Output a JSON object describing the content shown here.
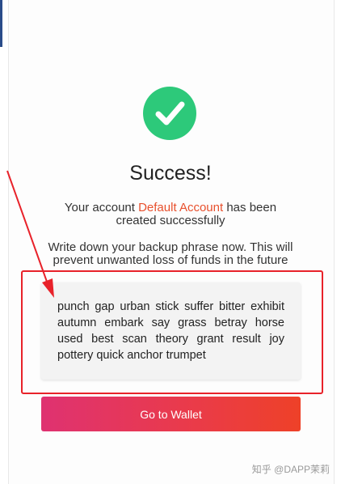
{
  "success": {
    "title": "Success!",
    "message_prefix": "Your account",
    "account_name": "Default Account",
    "message_suffix": "has been created successfully",
    "backup_instruction": "Write down your backup phrase now. This will prevent unwanted loss of funds in the future"
  },
  "backup_phrase": {
    "words": "punch gap urban stick suffer bitter exhibit autumn embark say grass betray horse used best scan theory grant result joy pottery quick anchor trumpet"
  },
  "actions": {
    "go_to_wallet_label": "Go to Wallet"
  },
  "watermark": {
    "text": "知乎 @DAPP茉莉"
  },
  "colors": {
    "success_green": "#2dc97a",
    "accent_orange": "#e8502d",
    "annotation_red": "#e8222a",
    "button_gradient_start": "#df3271",
    "button_gradient_end": "#ee4128"
  }
}
